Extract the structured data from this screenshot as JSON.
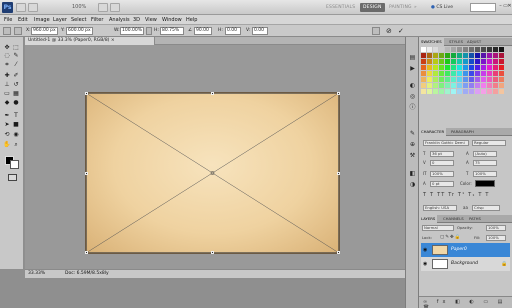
{
  "app": {
    "logo": "Ps",
    "zoom": "100%"
  },
  "workspaces": [
    "ESSENTIALS",
    "DESIGN",
    "PAINTING",
    "»"
  ],
  "cs_live": "CS Live",
  "window_buttons": [
    "–",
    "▭",
    "✕"
  ],
  "menu": [
    "File",
    "Edit",
    "Image",
    "Layer",
    "Select",
    "Filter",
    "Analysis",
    "3D",
    "View",
    "Window",
    "Help"
  ],
  "options": {
    "x_label": "X:",
    "x_value": "960.00 px",
    "y_label": "Y:",
    "y_value": "600.00 px",
    "w_label": "W:",
    "w_value": "100.00%",
    "h_label": "H:",
    "h_value": "80.75%",
    "angle_value": "90.00",
    "h2_value": "0.00",
    "v_value": "0.00",
    "cancel": "⊘",
    "commit": "✓"
  },
  "document": {
    "tab_title": "Untitled-1 @ 33.3% (Paper0, RGB/8) ×"
  },
  "status": {
    "zoom": "33.33%",
    "doc": "Doc: 6.59M/8.5x8ly"
  },
  "panels": {
    "swatch_tabs": [
      "SWATCHES",
      "STYLES",
      "ADJUST"
    ],
    "character_tabs": [
      "CHARACTER",
      "PARAGRAPH"
    ],
    "font_family": "Franklin Gothic Demi",
    "font_style": "Regular",
    "font_size": "36 pt",
    "leading": "(Auto)",
    "kerning": "0",
    "tracking": "75",
    "scale_v": "100%",
    "scale_h": "100%",
    "baseline": "0 pt",
    "color_label": "Color:",
    "language": "English: USA",
    "antialias": "Crisp",
    "layers_tabs": [
      "LAYERS",
      "CHANNELS",
      "PATHS"
    ],
    "blend_mode": "Normal",
    "opacity_label": "Opacity:",
    "opacity_value": "100%",
    "lock_label": "Lock:",
    "fill_label": "Fill:",
    "fill_value": "100%",
    "layers": [
      {
        "name": "Paper0",
        "selected": true,
        "thumb": "#f0d7a8"
      },
      {
        "name": "Background",
        "selected": false,
        "thumb": "#ffffff"
      }
    ]
  },
  "colors": {
    "accent": "#3a87d6",
    "fg": "#000000",
    "bg": "#ffffff"
  }
}
